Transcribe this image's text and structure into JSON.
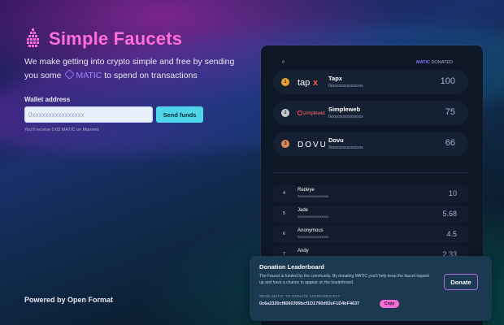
{
  "app": {
    "title": "Simple Faucets",
    "tagline_part1": "We make getting into crypto simple and free by sending you some",
    "tagline_token": "MATIC",
    "tagline_part2": "to spend on transactions",
    "brand_color": "#ff6ed9"
  },
  "wallet": {
    "label": "Wallet address",
    "placeholder": "0xxxxxxxxxxxxxxxx",
    "value": "",
    "send_label": "Send funds",
    "receive_note": "You'll receive 0.02 MATIC on Mainnet"
  },
  "footer": {
    "powered_by": "Powered by Open Format"
  },
  "leaderboard": {
    "col_rank": "#",
    "col_token": "MATIC",
    "col_donated": "DONATED",
    "top": [
      {
        "rank": "1",
        "name": "Tapx",
        "logo_text": "tapx",
        "address": "0xxxxxxxxxxxxxxxx",
        "amount": "100",
        "badge_color": "#e3a530"
      },
      {
        "rank": "2",
        "name": "Simpleweb",
        "logo_text": "simpleweb",
        "address": "0xxxxxxxxxxxxxxxx",
        "amount": "75",
        "badge_color": "#c8cbd3"
      },
      {
        "rank": "3",
        "name": "Dovu",
        "logo_text": "DOVU",
        "address": "0xxxxxxxxxxxxxxxx",
        "amount": "66",
        "badge_color": "#d98a5a"
      }
    ],
    "others": [
      {
        "rank": "4",
        "name": "Redeye",
        "address": "0xxxxxxxxxxxxxxxx",
        "amount": "10"
      },
      {
        "rank": "5",
        "name": "Jade",
        "address": "0xxxxxxxxxxxxxxxx",
        "amount": "5.68"
      },
      {
        "rank": "6",
        "name": "Anonymous",
        "address": "0xxxxxxxxxxxxxxxx",
        "amount": "4.5"
      },
      {
        "rank": "7",
        "name": "Andy",
        "address": "0xxxxxxxxxxxxxxxx",
        "amount": "2.33"
      }
    ]
  },
  "donation": {
    "title": "Donation Leaderboard",
    "text": "The Faucet is funded by the community. By donating MATIC you'll help keep the faucet topped up and have a chance to appear on the leaderboard.",
    "send_label": "SEND MATIC TO DONATE ANONYMOUSLY",
    "address": "0x6a2320cf8060399bcf1D1790d92eF1D4bF4637",
    "copy_label": "Copy",
    "donate_label": "Donate"
  }
}
